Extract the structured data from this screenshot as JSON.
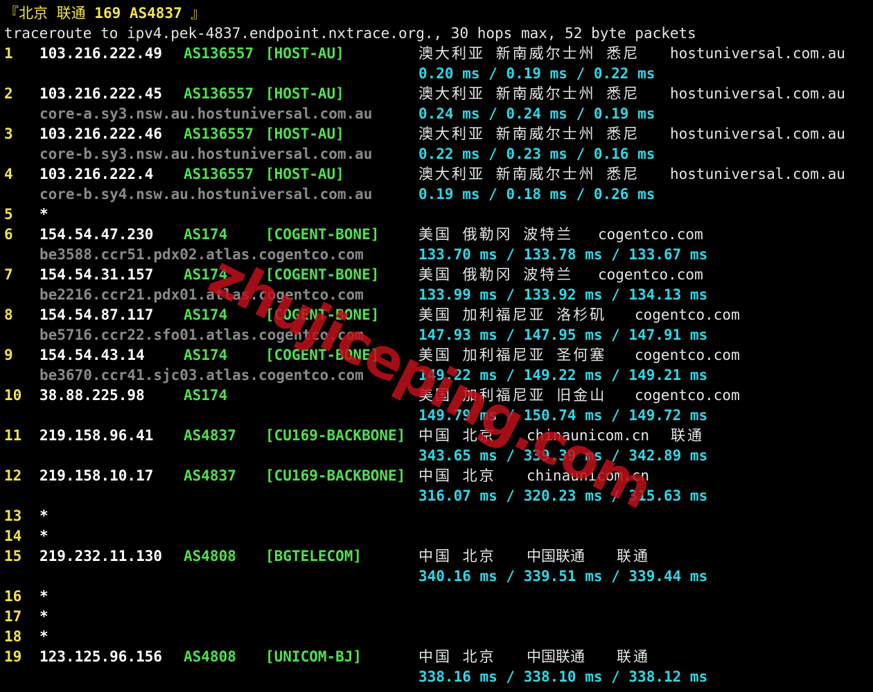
{
  "header": {
    "title_open": "『北京 联通 ",
    "title_bold": "169 AS4837",
    "title_close": " 』",
    "command": "traceroute to ipv4.pek-4837.endpoint.nxtrace.org., 30 hops max, 52 byte packets"
  },
  "watermark": "zhujiceping.com",
  "colors": {
    "background": "#000000",
    "hop_number": "#f2e34c",
    "asn": "#50e050",
    "rtt": "#2ed8e8",
    "hostname": "#8a8a8a",
    "watermark": "#c0101a"
  },
  "hops": [
    {
      "num": "1",
      "ip": "103.216.222.49",
      "asn": "AS136557",
      "tag": "[HOST-AU]",
      "geo": "澳大利亚 新南威尔士州 悉尼",
      "domain": "hostuniversal.com.au",
      "host": "",
      "rtt": "0.20 ms / 0.19 ms / 0.22 ms"
    },
    {
      "num": "2",
      "ip": "103.216.222.45",
      "asn": "AS136557",
      "tag": "[HOST-AU]",
      "geo": "澳大利亚 新南威尔士州 悉尼",
      "domain": "hostuniversal.com.au",
      "host": "core-a.sy3.nsw.au.hostuniversal.com.au",
      "rtt": "0.24 ms / 0.24 ms / 0.19 ms"
    },
    {
      "num": "3",
      "ip": "103.216.222.46",
      "asn": "AS136557",
      "tag": "[HOST-AU]",
      "geo": "澳大利亚 新南威尔士州 悉尼",
      "domain": "hostuniversal.com.au",
      "host": "core-b.sy3.nsw.au.hostuniversal.com.au",
      "rtt": "0.22 ms / 0.23 ms / 0.16 ms"
    },
    {
      "num": "4",
      "ip": "103.216.222.4",
      "asn": "AS136557",
      "tag": "[HOST-AU]",
      "geo": "澳大利亚 新南威尔士州 悉尼",
      "domain": "hostuniversal.com.au",
      "host": "core-b.sy4.nsw.au.hostuniversal.com.au",
      "rtt": "0.19 ms / 0.18 ms / 0.26 ms"
    },
    {
      "num": "5",
      "star": "*"
    },
    {
      "num": "6",
      "ip": "154.54.47.230",
      "asn": "AS174",
      "tag": "[COGENT-BONE]",
      "geo": "美国 俄勒冈 波特兰",
      "domain": "cogentco.com",
      "host": "be3588.ccr51.pdx02.atlas.cogentco.com",
      "rtt": "133.70 ms / 133.78 ms / 133.67 ms"
    },
    {
      "num": "7",
      "ip": "154.54.31.157",
      "asn": "AS174",
      "tag": "[COGENT-BONE]",
      "geo": "美国 俄勒冈 波特兰",
      "domain": "cogentco.com",
      "host": "be2216.ccr21.pdx01.atlas.cogentco.com",
      "rtt": "133.99 ms / 133.92 ms / 134.13 ms"
    },
    {
      "num": "8",
      "ip": "154.54.87.117",
      "asn": "AS174",
      "tag": "[COGENT-BONE]",
      "geo": "美国 加利福尼亚 洛杉矶",
      "domain": "cogentco.com",
      "host": "be5716.ccr22.sfo01.atlas.cogentco.com",
      "rtt": "147.93 ms / 147.95 ms / 147.91 ms"
    },
    {
      "num": "9",
      "ip": "154.54.43.14",
      "asn": "AS174",
      "tag": "[COGENT-BONE]",
      "geo": "美国 加利福尼亚 圣何塞",
      "domain": "cogentco.com",
      "host": "be3670.ccr41.sjc03.atlas.cogentco.com",
      "rtt": "149.22 ms / 149.22 ms / 149.21 ms"
    },
    {
      "num": "10",
      "ip": "38.88.225.98",
      "asn": "AS174",
      "tag": "",
      "geo": "美国 加利福尼亚 旧金山",
      "domain": "cogentco.com",
      "host": "",
      "rtt": "149.79 ms / 150.74 ms / 149.72 ms"
    },
    {
      "num": "11",
      "ip": "219.158.96.41",
      "asn": "AS4837",
      "tag": "[CU169-BACKBONE]",
      "geo": "中国 北京",
      "domain": "chinaunicom.cn",
      "isp": "联通",
      "host": "",
      "rtt": "343.65 ms / 339.39 ms / 342.89 ms"
    },
    {
      "num": "12",
      "ip": "219.158.10.17",
      "asn": "AS4837",
      "tag": "[CU169-BACKBONE]",
      "geo": "中国 北京",
      "domain": "chinaunicom.cn",
      "host": "",
      "rtt": "316.07 ms / 320.23 ms / 315.63 ms"
    },
    {
      "num": "13",
      "star": "*"
    },
    {
      "num": "14",
      "star": "*"
    },
    {
      "num": "15",
      "ip": "219.232.11.130",
      "asn": "AS4808",
      "tag": "[BGTELECOM]",
      "geo": "中国 北京",
      "domain": "中国联通",
      "isp": "联通",
      "host": "",
      "rtt": "340.16 ms / 339.51 ms / 339.44 ms"
    },
    {
      "num": "16",
      "star": "*"
    },
    {
      "num": "17",
      "star": "*"
    },
    {
      "num": "18",
      "star": "*"
    },
    {
      "num": "19",
      "ip": "123.125.96.156",
      "asn": "AS4808",
      "tag": "[UNICOM-BJ]",
      "geo": "中国 北京",
      "domain": "中国联通",
      "isp": "联通",
      "host": "",
      "rtt": "338.16 ms / 338.10 ms / 338.12 ms"
    }
  ]
}
